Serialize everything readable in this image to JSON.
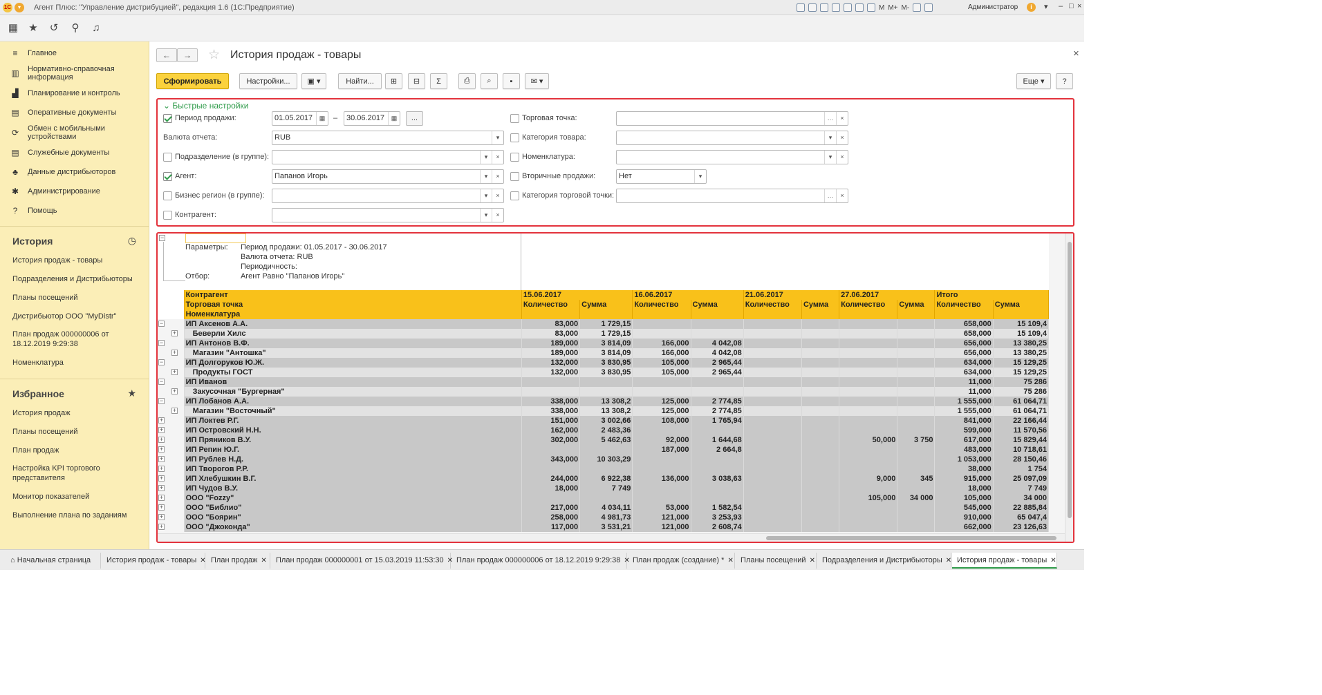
{
  "titlebar": {
    "text": "Агент Плюс: \"Управление дистрибуцией\", редакция 1.6  (1С:Предприятие)",
    "logo": "1С",
    "user": "Администратор",
    "toolbar_texts": [
      "М",
      "М+",
      "М-"
    ]
  },
  "sidebar": {
    "nav": [
      {
        "label": "Главное",
        "icon": "menu-icon"
      },
      {
        "label": "Нормативно-справочная информация",
        "icon": "grid-icon"
      },
      {
        "label": "Планирование и контроль",
        "icon": "chart-icon"
      },
      {
        "label": "Оперативные документы",
        "icon": "doc-icon"
      },
      {
        "label": "Обмен с мобильными устройствами",
        "icon": "sync-icon"
      },
      {
        "label": "Служебные документы",
        "icon": "doc-icon"
      },
      {
        "label": "Данные дистрибьюторов",
        "icon": "users-icon"
      },
      {
        "label": "Администрирование",
        "icon": "gear-icon"
      },
      {
        "label": "Помощь",
        "icon": "help-icon"
      }
    ],
    "history_title": "История",
    "history": [
      "История продаж - товары",
      "Подразделения и Дистрибьюторы",
      "Планы посещений",
      "Дистрибьютор ООО \"MyDistr\"",
      "План продаж 000000006 от 18.12.2019 9:29:38",
      "Номенклатура"
    ],
    "fav_title": "Избранное",
    "favorites": [
      "История продаж",
      "Планы посещений",
      "План продаж",
      "Настройка KPI торгового представителя",
      "Монитор показателей",
      "Выполнение плана по заданиям"
    ]
  },
  "page": {
    "title": "История продаж - товары"
  },
  "toolbar": {
    "generate": "Сформировать",
    "settings": "Настройки...",
    "find": "Найти...",
    "more": "Еще",
    "help": "?"
  },
  "quick": {
    "title": "Быстрые настройки",
    "period_label": "Период продажи:",
    "period_from": "01.05.2017",
    "period_to": "30.06.2017",
    "dash": "–",
    "dots": "...",
    "currency_label": "Валюта отчета:",
    "currency_value": "RUB",
    "division_label": "Подразделение (в группе):",
    "agent_label": "Агент:",
    "agent_value": "Папанов Игорь",
    "region_label": "Бизнес регион (в группе):",
    "contractor_label": "Контрагент:",
    "outlet_label": "Торговая точка:",
    "category_label": "Категория товара:",
    "nomen_label": "Номенклатура:",
    "secondary_label": "Вторичные продажи:",
    "secondary_value": "Нет",
    "outlet_cat_label": "Категория торговой точки:"
  },
  "report": {
    "params": [
      {
        "k": "Параметры:",
        "v": "Период продажи: 01.05.2017 - 30.06.2017"
      },
      {
        "k": "",
        "v": "Валюта отчета: RUB"
      },
      {
        "k": "",
        "v": "Периодичность:"
      },
      {
        "k": "Отбор:",
        "v": "Агент Равно \"Папанов Игорь\""
      }
    ],
    "header": {
      "c1": "Контрагент",
      "c2": "Торговая точка",
      "c3": "Номенклатура",
      "dates": [
        "15.06.2017",
        "16.06.2017",
        "21.06.2017",
        "27.06.2017",
        "Итого"
      ],
      "qty": "Количество",
      "sum": "Сумма"
    },
    "rows": [
      {
        "lvl": 0,
        "name": "ИП Аксенов А.А.",
        "v": [
          "83,000",
          "1 729,15",
          "",
          "",
          "",
          "",
          "",
          "",
          "658,000",
          "15 109,4"
        ]
      },
      {
        "lvl": 1,
        "name": "Беверли Хилс",
        "v": [
          "83,000",
          "1 729,15",
          "",
          "",
          "",
          "",
          "",
          "",
          "658,000",
          "15 109,4"
        ]
      },
      {
        "lvl": 0,
        "name": "ИП Антонов В.Ф.",
        "v": [
          "189,000",
          "3 814,09",
          "166,000",
          "4 042,08",
          "",
          "",
          "",
          "",
          "656,000",
          "13 380,25"
        ]
      },
      {
        "lvl": 1,
        "name": "Магазин \"Антошка\"",
        "v": [
          "189,000",
          "3 814,09",
          "166,000",
          "4 042,08",
          "",
          "",
          "",
          "",
          "656,000",
          "13 380,25"
        ]
      },
      {
        "lvl": 0,
        "name": "ИП Долгоруков Ю.Ж.",
        "v": [
          "132,000",
          "3 830,95",
          "105,000",
          "2 965,44",
          "",
          "",
          "",
          "",
          "634,000",
          "15 129,25"
        ]
      },
      {
        "lvl": 1,
        "name": "Продукты ГОСТ",
        "v": [
          "132,000",
          "3 830,95",
          "105,000",
          "2 965,44",
          "",
          "",
          "",
          "",
          "634,000",
          "15 129,25"
        ]
      },
      {
        "lvl": 0,
        "name": "ИП Иванов",
        "v": [
          "",
          "",
          "",
          "",
          "",
          "",
          "",
          "",
          "11,000",
          "75 286"
        ]
      },
      {
        "lvl": 1,
        "name": "Закусочная \"Бургерная\"",
        "v": [
          "",
          "",
          "",
          "",
          "",
          "",
          "",
          "",
          "11,000",
          "75 286"
        ]
      },
      {
        "lvl": 0,
        "name": "ИП Лобанов А.А.",
        "v": [
          "338,000",
          "13 308,2",
          "125,000",
          "2 774,85",
          "",
          "",
          "",
          "",
          "1 555,000",
          "61 064,71"
        ]
      },
      {
        "lvl": 1,
        "name": "Магазин \"Восточный\"",
        "v": [
          "338,000",
          "13 308,2",
          "125,000",
          "2 774,85",
          "",
          "",
          "",
          "",
          "1 555,000",
          "61 064,71"
        ]
      },
      {
        "lvl": 2,
        "name": "ИП Локтев Р.Г.",
        "v": [
          "151,000",
          "3 002,66",
          "108,000",
          "1 765,94",
          "",
          "",
          "",
          "",
          "841,000",
          "22 166,44"
        ]
      },
      {
        "lvl": 2,
        "name": "ИП Островский Н.Н.",
        "v": [
          "162,000",
          "2 483,36",
          "",
          "",
          "",
          "",
          "",
          "",
          "599,000",
          "11 570,56"
        ]
      },
      {
        "lvl": 2,
        "name": "ИП Пряников В.У.",
        "v": [
          "302,000",
          "5 462,63",
          "92,000",
          "1 644,68",
          "",
          "",
          "50,000",
          "3 750",
          "617,000",
          "15 829,44"
        ]
      },
      {
        "lvl": 2,
        "name": "ИП Репин Ю.Г.",
        "v": [
          "",
          "",
          "187,000",
          "2 664,8",
          "",
          "",
          "",
          "",
          "483,000",
          "10 718,61"
        ]
      },
      {
        "lvl": 2,
        "name": "ИП Рублев Н.Д.",
        "v": [
          "343,000",
          "10 303,29",
          "",
          "",
          "",
          "",
          "",
          "",
          "1 053,000",
          "28 150,46"
        ]
      },
      {
        "lvl": 2,
        "name": "ИП Творогов Р.Р.",
        "v": [
          "",
          "",
          "",
          "",
          "",
          "",
          "",
          "",
          "38,000",
          "1 754"
        ]
      },
      {
        "lvl": 2,
        "name": "ИП Хлебушкин В.Г.",
        "v": [
          "244,000",
          "6 922,38",
          "136,000",
          "3 038,63",
          "",
          "",
          "9,000",
          "345",
          "915,000",
          "25 097,09"
        ]
      },
      {
        "lvl": 2,
        "name": "ИП Чудов В.У.",
        "v": [
          "18,000",
          "7 749",
          "",
          "",
          "",
          "",
          "",
          "",
          "18,000",
          "7 749"
        ]
      },
      {
        "lvl": 2,
        "name": "ООО \"Fozzy\"",
        "v": [
          "",
          "",
          "",
          "",
          "",
          "",
          "105,000",
          "34 000",
          "105,000",
          "34 000"
        ]
      },
      {
        "lvl": 2,
        "name": "ООО \"Библио\"",
        "v": [
          "217,000",
          "4 034,11",
          "53,000",
          "1 582,54",
          "",
          "",
          "",
          "",
          "545,000",
          "22 885,84"
        ]
      },
      {
        "lvl": 2,
        "name": "ООО \"Боярин\"",
        "v": [
          "258,000",
          "4 981,73",
          "121,000",
          "3 253,93",
          "",
          "",
          "",
          "",
          "910,000",
          "65 047,4"
        ]
      },
      {
        "lvl": 2,
        "name": "ООО \"Джоконда\"",
        "v": [
          "117,000",
          "3 531,21",
          "121,000",
          "2 608,74",
          "",
          "",
          "",
          "",
          "662,000",
          "23 126,63"
        ]
      }
    ]
  },
  "tabs": [
    "Начальная страница",
    "История продаж - товары",
    "План продаж",
    "План продаж 000000001 от 15.03.2019 11:53:30",
    "План продаж 000000006 от 18.12.2019 9:29:38",
    "План продаж (создание) *",
    "Планы посещений",
    "Подразделения и Дистрибьюторы",
    "История продаж - товары"
  ],
  "colors": {
    "sidebar": "#fbeeb7",
    "accent": "#fbd23d",
    "header": "#f9c11a",
    "frame": "#e3323c",
    "green": "#2d9a48"
  }
}
